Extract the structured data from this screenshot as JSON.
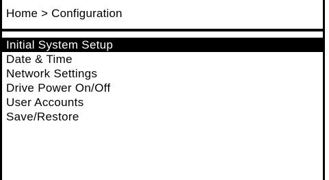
{
  "breadcrumb": "Home > Configuration",
  "menu": {
    "selected_index": 0,
    "items": [
      {
        "label": "Initial System Setup"
      },
      {
        "label": "Date & Time"
      },
      {
        "label": "Network Settings"
      },
      {
        "label": "Drive Power On/Off"
      },
      {
        "label": "User Accounts"
      },
      {
        "label": "Save/Restore"
      }
    ]
  },
  "colors": {
    "background": "#ffffff",
    "foreground": "#000000",
    "highlight_bg": "#000000",
    "highlight_fg": "#ffffff"
  }
}
